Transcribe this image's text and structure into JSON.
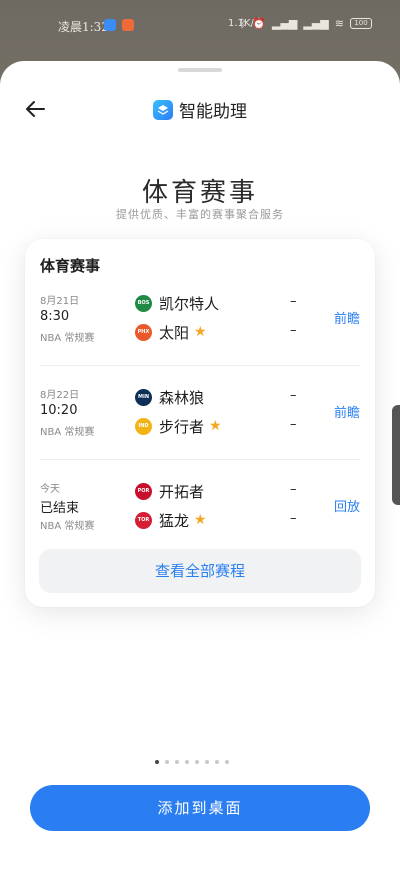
{
  "status_bar": {
    "time": "凌晨1:32",
    "net_speed": "1.1K/s",
    "battery": "100"
  },
  "header": {
    "title": "智能助理"
  },
  "hero": {
    "title": "体育赛事",
    "subtitle": "提供优质、丰富的赛事聚合服务"
  },
  "card": {
    "title": "体育赛事",
    "matches": [
      {
        "date": "8月21日",
        "time": "8:30",
        "league": "NBA 常规赛",
        "team1": {
          "name": "凯尔特人",
          "logo": "BOS",
          "color": "#1f8a45"
        },
        "team2": {
          "name": "太阳",
          "logo": "PHX",
          "color": "#e8582a"
        },
        "score1": "–",
        "score2": "–",
        "action": "前瞻"
      },
      {
        "date": "8月22日",
        "time": "10:20",
        "league": "NBA 常规赛",
        "team1": {
          "name": "森林狼",
          "logo": "MIN",
          "color": "#0e2f58"
        },
        "team2": {
          "name": "步行者",
          "logo": "IND",
          "color": "#f2b414"
        },
        "score1": "–",
        "score2": "–",
        "action": "前瞻"
      },
      {
        "date": "今天",
        "time": "已结束",
        "league": "NBA 常规赛",
        "team1": {
          "name": "开拓者",
          "logo": "POR",
          "color": "#c8102e"
        },
        "team2": {
          "name": "猛龙",
          "logo": "TOR",
          "color": "#d61f36"
        },
        "score1": "–",
        "score2": "–",
        "action": "回放"
      }
    ],
    "view_all": "查看全部赛程"
  },
  "pager": {
    "count": 8,
    "active": 0
  },
  "add_button": "添加到桌面",
  "colors": {
    "accent": "#2b7ef2",
    "star": "#f5a623"
  }
}
